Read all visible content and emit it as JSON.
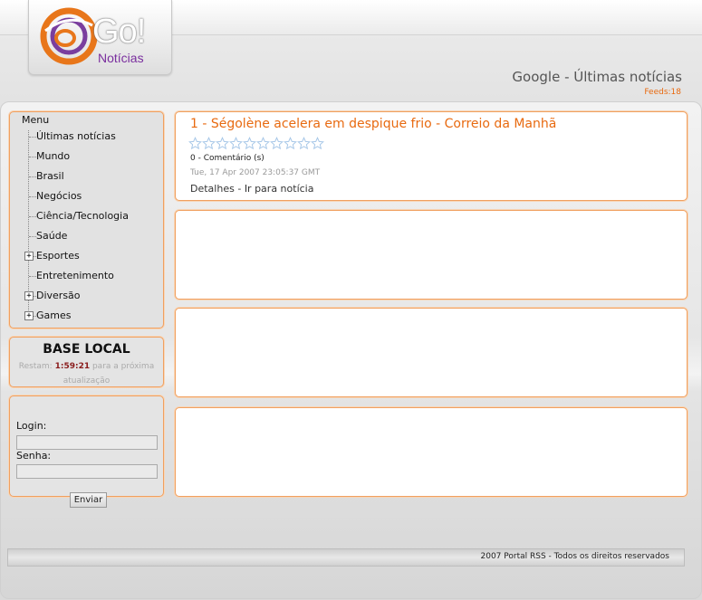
{
  "site": {
    "logo_text": "Go!",
    "logo_sub": "Notícias",
    "page_title": "Google - Últimas notícias",
    "feeds": "Feeds:18"
  },
  "menu": {
    "heading": "Menu",
    "items": [
      {
        "label": "Últimas notícias",
        "expandable": false
      },
      {
        "label": "Mundo",
        "expandable": false
      },
      {
        "label": "Brasil",
        "expandable": false
      },
      {
        "label": "Negócios",
        "expandable": false
      },
      {
        "label": "Ciência/Tecnologia",
        "expandable": false
      },
      {
        "label": "Saúde",
        "expandable": false
      },
      {
        "label": "Esportes",
        "expandable": true
      },
      {
        "label": "Entretenimento",
        "expandable": false
      },
      {
        "label": "Diversão",
        "expandable": true
      },
      {
        "label": "Games",
        "expandable": true
      }
    ]
  },
  "base_local": {
    "title": "BASE LOCAL",
    "prefix": "Restam:",
    "time": "1:59:21",
    "suffix": "para a próxima atualização"
  },
  "login": {
    "login_label": "Login:",
    "password_label": "Senha:",
    "submit_label": "Enviar",
    "login_value": "",
    "password_value": ""
  },
  "news": [
    {
      "title": "1 - Ségolène acelera em despique frio - Correio da Manhã",
      "rating": 0,
      "star_count": 10,
      "comments": "0 - Comentário (s)",
      "date": "Tue, 17 Apr 2007 23:05:37 GMT",
      "details_link": "Detalhes",
      "separator": "-",
      "open_link": "Ir para notícia"
    }
  ],
  "footer": {
    "text": "2007 Portal RSS  -  Todos os direitos reservados"
  },
  "colors": {
    "accent": "#e86a10",
    "box_border": "#f0a060",
    "timer": "#8a1c1c"
  }
}
